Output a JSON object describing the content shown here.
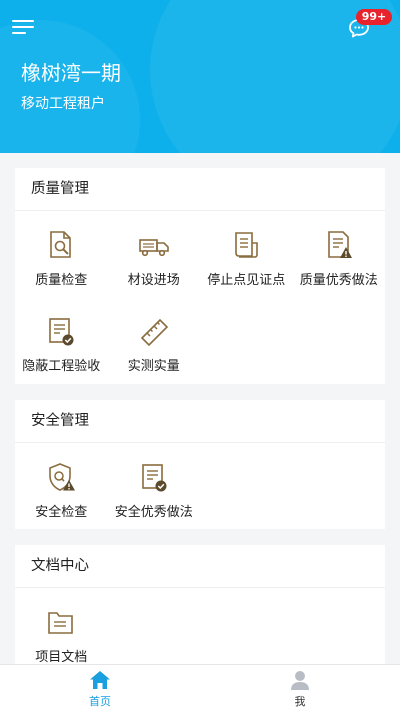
{
  "header": {
    "project_name": "橡树湾一期",
    "tenant_type": "移动工程租户",
    "notification_badge": "99+",
    "menu_icon": "hamburger-menu-icon",
    "message_icon": "chat-bubble-icon"
  },
  "sections": [
    {
      "title": "质量管理",
      "items": [
        {
          "label": "质量检查",
          "icon": "document-search-icon"
        },
        {
          "label": "材设进场",
          "icon": "delivery-truck-icon"
        },
        {
          "label": "停止点见证点",
          "icon": "document-scroll-icon"
        },
        {
          "label": "质量优秀做法",
          "icon": "document-warning-icon"
        },
        {
          "label": "隐蔽工程验收",
          "icon": "document-check-icon"
        },
        {
          "label": "实测实量",
          "icon": "ruler-icon"
        }
      ]
    },
    {
      "title": "安全管理",
      "items": [
        {
          "label": "安全检查",
          "icon": "shield-warning-icon"
        },
        {
          "label": "安全优秀做法",
          "icon": "document-check-icon"
        }
      ]
    },
    {
      "title": "文档中心",
      "items": [
        {
          "label": "项目文档",
          "icon": "folder-icon"
        }
      ]
    }
  ],
  "tabbar": {
    "home": {
      "label": "首页",
      "icon": "home-icon",
      "active": true
    },
    "me": {
      "label": "我",
      "icon": "user-icon",
      "active": false
    }
  },
  "colors": {
    "header_bg": "#0db0ea",
    "icon_brown": "#8a6c3e",
    "active_tab": "#1a9fe0",
    "badge": "#e8232b"
  }
}
